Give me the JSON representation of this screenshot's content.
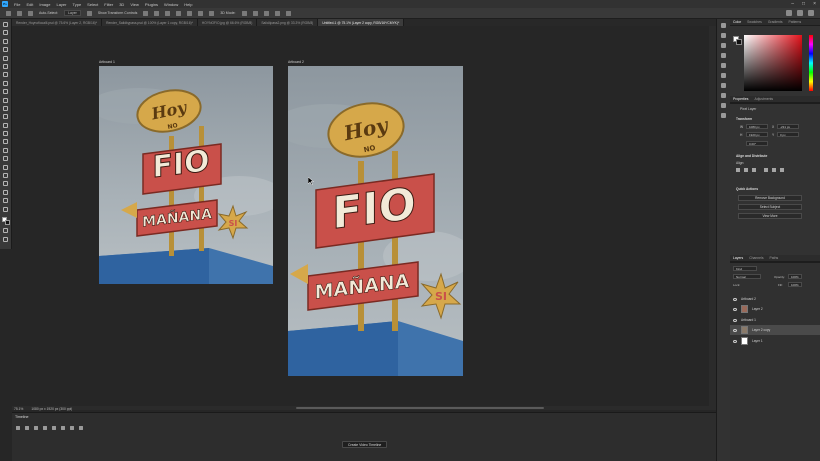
{
  "menubar": {
    "items": [
      "File",
      "Edit",
      "Image",
      "Layer",
      "Type",
      "Select",
      "Filter",
      "3D",
      "View",
      "Plugins",
      "Window",
      "Help"
    ]
  },
  "options": {
    "auto_select_label": "Auto-Select:",
    "auto_select_value": "Layer",
    "show_transform_label": "Show Transform Controls",
    "mode_3d_label": "3D Mode:"
  },
  "tabs": [
    {
      "label": "Render_Hoynofiocalli.psd @ 75.6% (Layer 2, RGB/16)*",
      "active": false
    },
    {
      "label": "Render_Salidbypass.psd @ 100% (Layer 1 copy, RGB/16)*",
      "active": false
    },
    {
      "label": "HOYNOFIO.jpg @ 66.6% (RGB/8)",
      "active": false
    },
    {
      "label": "Salid4pass2.png @ 33.3% (RGB/8)",
      "active": false
    },
    {
      "label": "Untitled-1 @ 75.1% (Layer 2 copy, RGB/16*/CMYK)*",
      "active": true
    }
  ],
  "artboards": [
    {
      "label": "Artboard 1"
    },
    {
      "label": "Artboard 2"
    }
  ],
  "sign": {
    "top_line1": "Hoy",
    "top_line2": "NO",
    "middle": "FIO",
    "bottom": "MAÑANA",
    "burst": "SI"
  },
  "status": {
    "zoom": "75.1%",
    "doc_size": "1080 px x 1920 px (300 ppi)"
  },
  "timeline": {
    "title": "Timeline",
    "create_button": "Create Video Timeline"
  },
  "panels": {
    "color_tabs": [
      "Color",
      "Swatches",
      "Gradients",
      "Patterns"
    ],
    "properties_tabs": [
      "Properties",
      "Adjustments"
    ],
    "pixel_layer": "Pixel Layer",
    "transform_title": "Transform",
    "w_label": "W",
    "w_value": "1080 px",
    "h_label": "H",
    "h_value": "1920 px",
    "x_label": "X",
    "x_value": "-231 px",
    "y_label": "Y",
    "y_value": "0 px",
    "angle_value": "0.00°",
    "align_title": "Align and Distribute",
    "align_label": "Align:",
    "quick_actions_title": "Quick Actions",
    "qa_remove_bg": "Remove Background",
    "qa_select_subject": "Select Subject",
    "qa_view_more": "View More",
    "layers_tabs": [
      "Layers",
      "Channels",
      "Paths"
    ],
    "kind_label": "Kind",
    "blend_mode": "Normal",
    "opacity_label": "Opacity:",
    "opacity_value": "100%",
    "lock_label": "Lock:",
    "fill_label": "Fill:",
    "fill_value": "100%",
    "layers": [
      {
        "name": "Artboard 2",
        "type": "artboard",
        "selected": false
      },
      {
        "name": "Layer 2",
        "type": "layer",
        "selected": false
      },
      {
        "name": "Artboard 1",
        "type": "artboard",
        "selected": false
      },
      {
        "name": "Layer 2 copy",
        "type": "layer",
        "selected": true
      },
      {
        "name": "Layer 1",
        "type": "layer",
        "selected": false
      }
    ]
  },
  "colors": {
    "accent": "#31a8ff",
    "sign_red": "#c9504a",
    "sign_gold": "#d6a84a",
    "sky": "#9aa5ad"
  }
}
